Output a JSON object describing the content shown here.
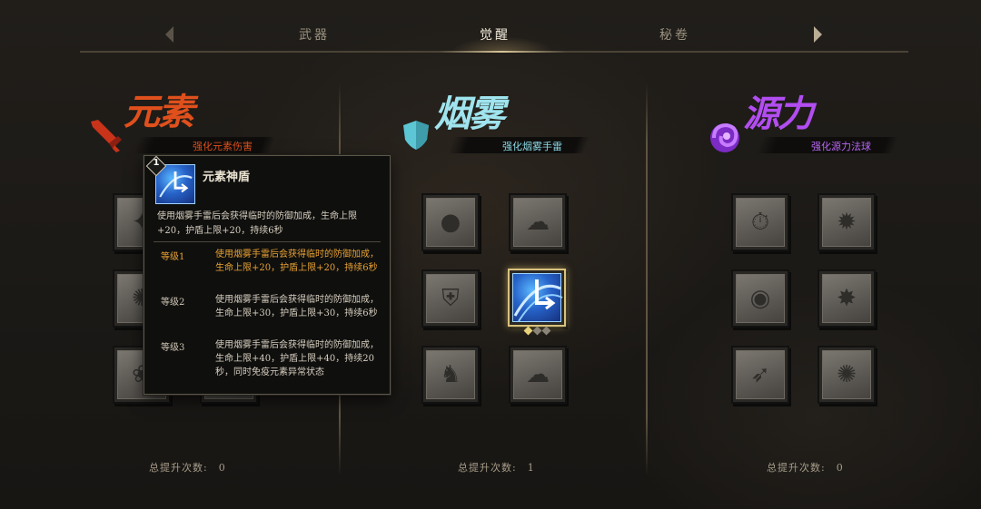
{
  "tabs": [
    {
      "label": "武器"
    },
    {
      "label": "觉醒"
    },
    {
      "label": "秘卷"
    }
  ],
  "colors": {
    "element": "#e0501c",
    "smoke": "#5cc6d4",
    "source": "#a542e0",
    "current_level": "#e8a233",
    "selected_border": "#d9c27d",
    "pip_active": "#e8d27a",
    "pip_inactive": "#8a8478"
  },
  "columns": [
    {
      "title": "元素",
      "subtitle": "强化元素伤害",
      "icon": "sword-icon",
      "count_label": "总提升次数:",
      "count_value": "0",
      "slots": [
        {
          "icon": "skill-icon"
        },
        {
          "icon": "skill-icon"
        },
        {
          "icon": "skill-icon"
        },
        {
          "icon": "skill-icon"
        },
        {
          "icon": "skill-icon"
        },
        {
          "icon": "skill-icon"
        }
      ]
    },
    {
      "title": "烟雾",
      "subtitle": "强化烟雾手雷",
      "icon": "shield-icon",
      "count_label": "总提升次数:",
      "count_value": "1",
      "slots": [
        {
          "icon": "grenade-icon"
        },
        {
          "icon": "mask-icon"
        },
        {
          "icon": "armor-icon"
        },
        {
          "icon": "element-shield-icon",
          "selected": true,
          "level": 1,
          "max_level": 3
        },
        {
          "icon": "crouch-icon"
        },
        {
          "icon": "smoke-cloud-icon"
        }
      ]
    },
    {
      "title": "源力",
      "subtitle": "强化源力法球",
      "icon": "orb-swirl-icon",
      "count_label": "总提升次数:",
      "count_value": "0",
      "slots": [
        {
          "icon": "timer-icon"
        },
        {
          "icon": "explosion-icon"
        },
        {
          "icon": "orb-icon"
        },
        {
          "icon": "burst-icon"
        },
        {
          "icon": "arrow-face-icon"
        },
        {
          "icon": "blast-icon"
        }
      ]
    }
  ],
  "tooltip": {
    "badge": "1",
    "title": "元素神盾",
    "description": "使用烟雾手雷后会获得临时的防御加成，生命上限+20，护盾上限+20，持续6秒",
    "levels": [
      {
        "label": "等级1",
        "text": "使用烟雾手雷后会获得临时的防御加成，生命上限+20，护盾上限+20，持续6秒",
        "current": true
      },
      {
        "label": "等级2",
        "text": "使用烟雾手雷后会获得临时的防御加成，生命上限+30，护盾上限+30，持续6秒",
        "current": false
      },
      {
        "label": "等级3",
        "text": "使用烟雾手雷后会获得临时的防御加成，生命上限+40，护盾上限+40，持续20秒，同时免疫元素异常状态",
        "current": false
      }
    ]
  }
}
